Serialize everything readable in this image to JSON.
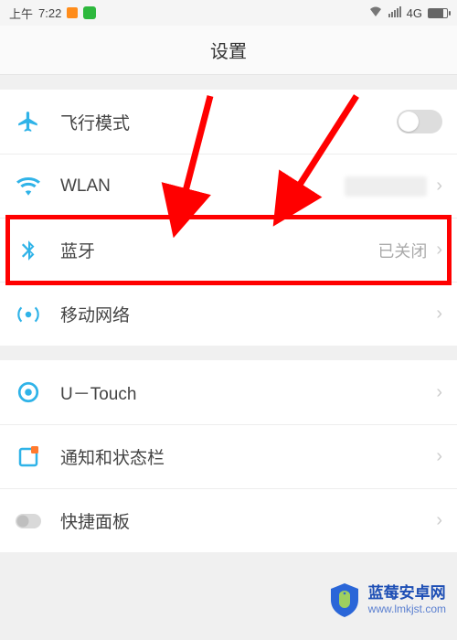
{
  "status": {
    "time_prefix": "上午",
    "time": "7:22",
    "network": "4G"
  },
  "header": {
    "title": "设置"
  },
  "group1": {
    "airplane": {
      "label": "飞行模式"
    },
    "wlan": {
      "label": "WLAN"
    },
    "bluetooth": {
      "label": "蓝牙",
      "value": "已关闭"
    },
    "mobile": {
      "label": "移动网络"
    }
  },
  "group2": {
    "utouch": {
      "label": "U－Touch"
    },
    "notif": {
      "label": "通知和状态栏"
    },
    "quickpanel": {
      "label": "快捷面板"
    }
  },
  "watermark": {
    "title": "蓝莓安卓网",
    "url": "www.lmkjst.com"
  },
  "icons": {
    "airplane": "airplane-icon",
    "wlan": "wifi-icon",
    "bluetooth": "bluetooth-icon",
    "mobile": "cell-tower-icon",
    "utouch": "target-icon",
    "notif": "notification-icon",
    "quickpanel": "toggle-icon"
  },
  "colors": {
    "icon_blue": "#2fb3e8",
    "icon_gray": "#bfbfbf",
    "arrow_red": "#ff0000"
  }
}
